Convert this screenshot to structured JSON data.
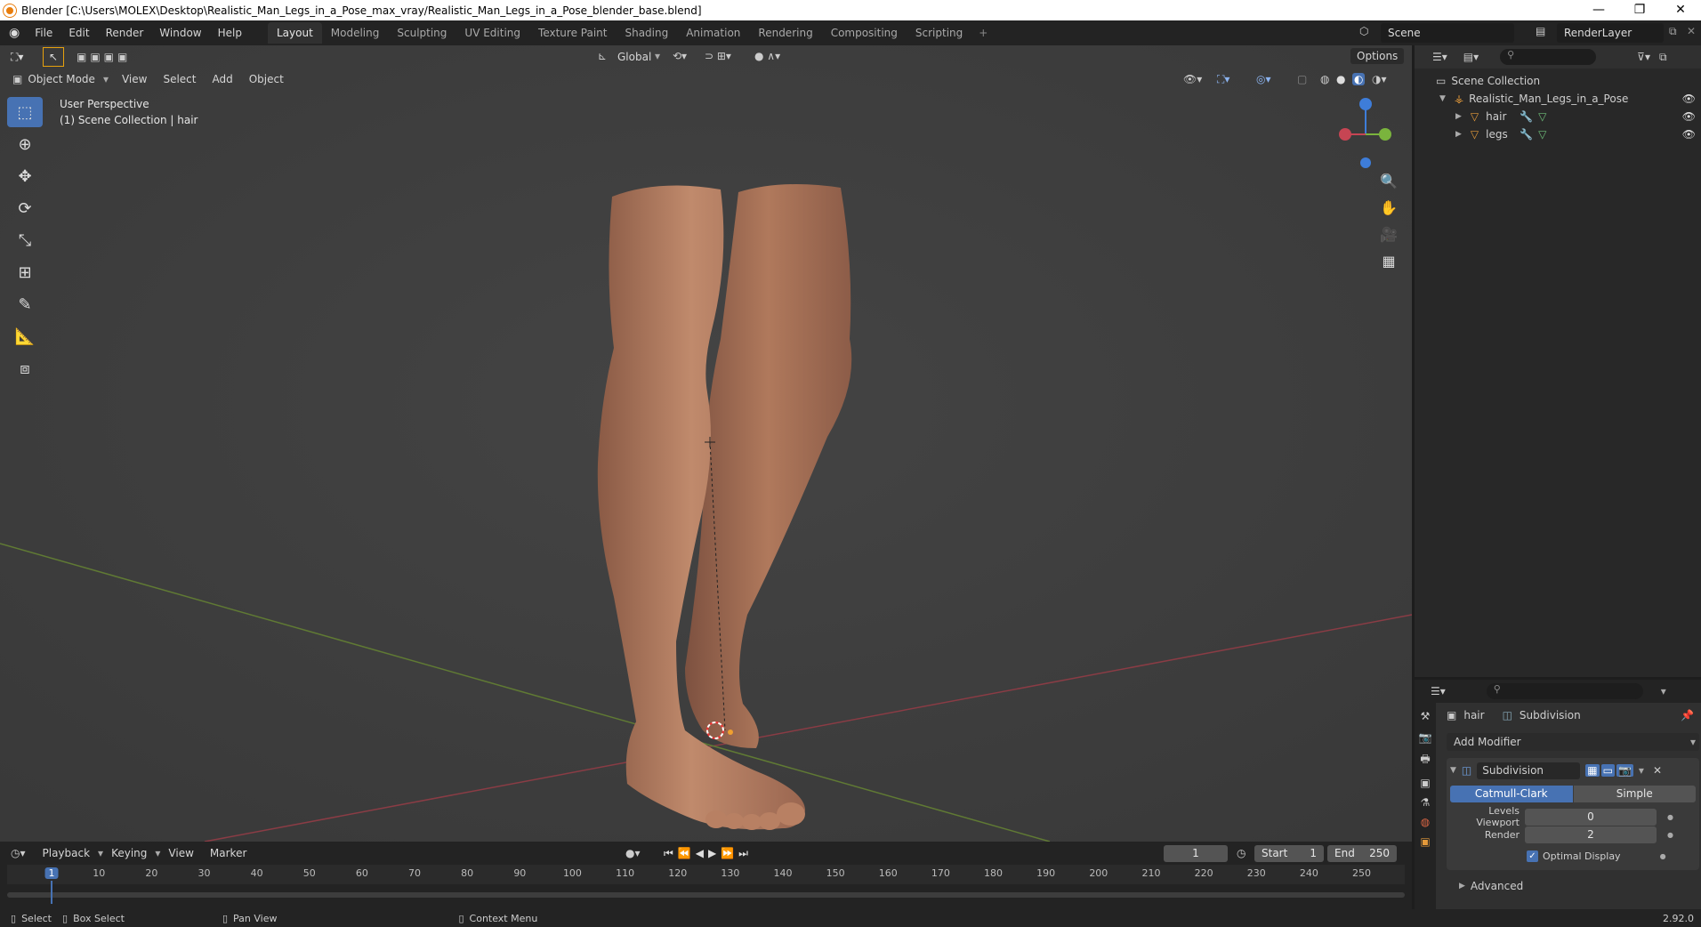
{
  "window": {
    "title": "Blender [C:\\Users\\MOLEX\\Desktop\\Realistic_Man_Legs_in_a_Pose_max_vray/Realistic_Man_Legs_in_a_Pose_blender_base.blend]",
    "minimize": "—",
    "maximize": "❐",
    "close": "✕"
  },
  "menu": [
    "File",
    "Edit",
    "Render",
    "Window",
    "Help"
  ],
  "workspaces": [
    "Layout",
    "Modeling",
    "Sculpting",
    "UV Editing",
    "Texture Paint",
    "Shading",
    "Animation",
    "Rendering",
    "Compositing",
    "Scripting"
  ],
  "workspace_add": "+",
  "scene": "Scene",
  "render_layer": "RenderLayer",
  "viewport": {
    "orientation": "Global",
    "options": "Options",
    "mode": "Object Mode",
    "header_menus": [
      "View",
      "Select",
      "Add",
      "Object"
    ],
    "info_line1": "User Perspective",
    "info_line2": "(1) Scene Collection | hair"
  },
  "outliner": {
    "root": "Scene Collection",
    "collection": "Realistic_Man_Legs_in_a_Pose",
    "objects": [
      "hair",
      "legs"
    ]
  },
  "properties": {
    "object": "hair",
    "modifier_crumb": "Subdivision",
    "add_modifier": "Add Modifier",
    "modifier_name": "Subdivision",
    "type_catmull": "Catmull-Clark",
    "type_simple": "Simple",
    "levels_viewport_label": "Levels Viewport",
    "levels_viewport_value": "0",
    "render_label": "Render",
    "render_value": "2",
    "optimal_display": "Optimal Display",
    "advanced": "Advanced",
    "version": "2.92.0"
  },
  "timeline": {
    "menus": [
      "Playback",
      "Keying",
      "View",
      "Marker"
    ],
    "current_frame": "1",
    "start_label": "Start",
    "start_value": "1",
    "end_label": "End",
    "end_value": "250",
    "ruler": [
      "1",
      "10",
      "20",
      "30",
      "40",
      "50",
      "60",
      "70",
      "80",
      "90",
      "100",
      "110",
      "120",
      "130",
      "140",
      "150",
      "160",
      "170",
      "180",
      "190",
      "200",
      "210",
      "220",
      "230",
      "240",
      "250"
    ]
  },
  "status": {
    "select": "Select",
    "box_select": "Box Select",
    "pan_view": "Pan View",
    "context_menu": "Context Menu"
  },
  "colors": {
    "accent": "#4772b3",
    "x_axis": "#c64553",
    "y_axis": "#7ab43d",
    "z_axis": "#3e7dd9",
    "skin": "#b07a5f"
  }
}
